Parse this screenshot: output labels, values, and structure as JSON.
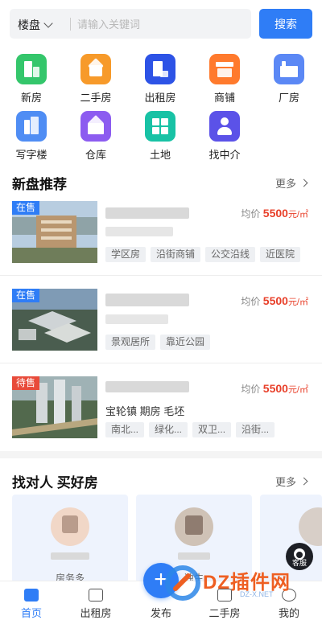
{
  "search": {
    "city": "楼盘",
    "placeholder": "请输入关键词",
    "button": "搜索"
  },
  "categories": [
    {
      "label": "新房",
      "icon": "building-icon",
      "color": "#34c66b"
    },
    {
      "label": "二手房",
      "icon": "house-icon",
      "color": "#f79a2a"
    },
    {
      "label": "出租房",
      "icon": "rent-icon",
      "color": "#2d53e6"
    },
    {
      "label": "商铺",
      "icon": "shop-icon",
      "color": "#ff7a2d"
    },
    {
      "label": "厂房",
      "icon": "factory-icon",
      "color": "#5b88f5"
    },
    {
      "label": "写字楼",
      "icon": "office-icon",
      "color": "#4f8df4"
    },
    {
      "label": "仓库",
      "icon": "warehouse-icon",
      "color": "#8c5cf0"
    },
    {
      "label": "土地",
      "icon": "land-icon",
      "color": "#18c2a5"
    },
    {
      "label": "找中介",
      "icon": "agent-icon",
      "color": "#5b52e8"
    }
  ],
  "new_homes": {
    "title": "新盘推荐",
    "more": "更多",
    "items": [
      {
        "status": "在售",
        "status_color": "#2f7df6",
        "price_label": "均价",
        "price": "5500",
        "unit": "元/㎡",
        "tags": [
          "学区房",
          "沿街商铺",
          "公交沿线",
          "近医院"
        ]
      },
      {
        "status": "在售",
        "status_color": "#2f7df6",
        "price_label": "均价",
        "price": "5500",
        "unit": "元/㎡",
        "tags": [
          "景观居所",
          "靠近公园"
        ]
      },
      {
        "status": "待售",
        "status_color": "#e84b3a",
        "price_label": "均价",
        "price": "5500",
        "unit": "元/㎡",
        "address": "宝轮镇 期房 毛坯",
        "tags": [
          "南北...",
          "绿化...",
          "双卫...",
          "沿街..."
        ]
      }
    ]
  },
  "agents": {
    "title": "找对人 买好房",
    "more": "更多",
    "cards": [
      {
        "role": "房务多"
      },
      {
        "role": "独生"
      },
      {
        "role": ""
      }
    ]
  },
  "service": {
    "label": "客服"
  },
  "tabbar": [
    {
      "label": "首页",
      "icon": "home-icon",
      "active": true
    },
    {
      "label": "出租房",
      "icon": "rent-tab-icon",
      "active": false
    },
    {
      "label": "发布",
      "icon": "plus-icon",
      "active": false
    },
    {
      "label": "二手房",
      "icon": "house-tab-icon",
      "active": false
    },
    {
      "label": "我的",
      "icon": "user-icon",
      "active": false
    }
  ],
  "watermark": {
    "text": "DZ插件网",
    "sub": "DZ-X.NET"
  }
}
